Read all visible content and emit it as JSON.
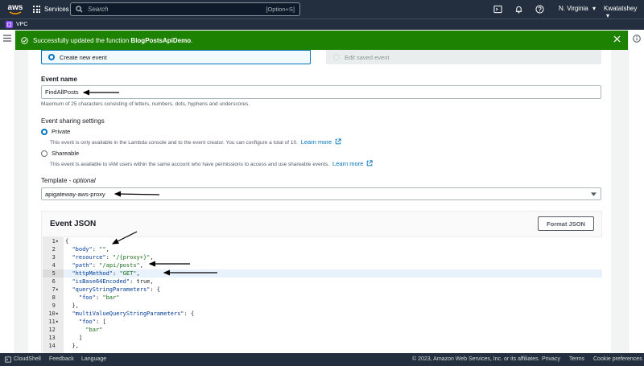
{
  "topnav": {
    "logo_text": "aws",
    "services_label": "Services",
    "search_placeholder": "Search",
    "search_shortcut": "[Option+S]",
    "region": "N. Virginia",
    "user": "Kwatatshey"
  },
  "service_bar": {
    "label": "VPC"
  },
  "flash": {
    "message_prefix": "Successfully updated the function ",
    "function_name": "BlogPostsApiDemo",
    "message_suffix": "."
  },
  "event_type": {
    "create_label": "Create new event",
    "saved_label": "Edit saved event",
    "selected": "create"
  },
  "event_name": {
    "label": "Event name",
    "value": "FindAllPosts",
    "hint": "Maximum of 25 characters consisting of letters, numbers, dots, hyphens and underscores."
  },
  "sharing": {
    "label": "Event sharing settings",
    "private_label": "Private",
    "private_desc": "This event is only available in the Lambda console and to the event creator. You can configure a total of 10.",
    "shareable_label": "Shareable",
    "shareable_desc": "This event is available to IAM users within the same account who have permissions to access and use shareable events.",
    "learn_more": "Learn more",
    "selected": "private"
  },
  "template": {
    "label": "Template",
    "optional": "optional",
    "value": "apigateway-aws-proxy"
  },
  "json_editor": {
    "title": "Event JSON",
    "format_button": "Format JSON",
    "active_line": 5,
    "lines": [
      {
        "n": "1",
        "fold": true,
        "text": "{"
      },
      {
        "n": "2",
        "fold": false,
        "text": "  \"body\": \"\","
      },
      {
        "n": "3",
        "fold": false,
        "text": "  \"resource\": \"/{proxy+}\","
      },
      {
        "n": "4",
        "fold": false,
        "text": "  \"path\": \"/api/posts\","
      },
      {
        "n": "5",
        "fold": false,
        "text": "  \"httpMethod\": \"GET\","
      },
      {
        "n": "6",
        "fold": false,
        "text": "  \"isBase64Encoded\": true,"
      },
      {
        "n": "7",
        "fold": true,
        "text": "  \"queryStringParameters\": {"
      },
      {
        "n": "8",
        "fold": false,
        "text": "    \"foo\": \"bar\""
      },
      {
        "n": "9",
        "fold": false,
        "text": "  },"
      },
      {
        "n": "10",
        "fold": true,
        "text": "  \"multiValueQueryStringParameters\": {"
      },
      {
        "n": "11",
        "fold": true,
        "text": "    \"foo\": ["
      },
      {
        "n": "12",
        "fold": false,
        "text": "      \"bar\""
      },
      {
        "n": "13",
        "fold": false,
        "text": "    ]"
      },
      {
        "n": "14",
        "fold": false,
        "text": "  },"
      }
    ]
  },
  "footer": {
    "cloudshell": "CloudShell",
    "feedback": "Feedback",
    "language": "Language",
    "copyright": "© 2023, Amazon Web Services, Inc. or its affiliates.",
    "privacy": "Privacy",
    "terms": "Terms",
    "cookies": "Cookie preferences"
  },
  "colors": {
    "nav_bg": "#232f3e",
    "success": "#1d8102",
    "link": "#0073bb",
    "annotation_arrow": "#000000"
  }
}
